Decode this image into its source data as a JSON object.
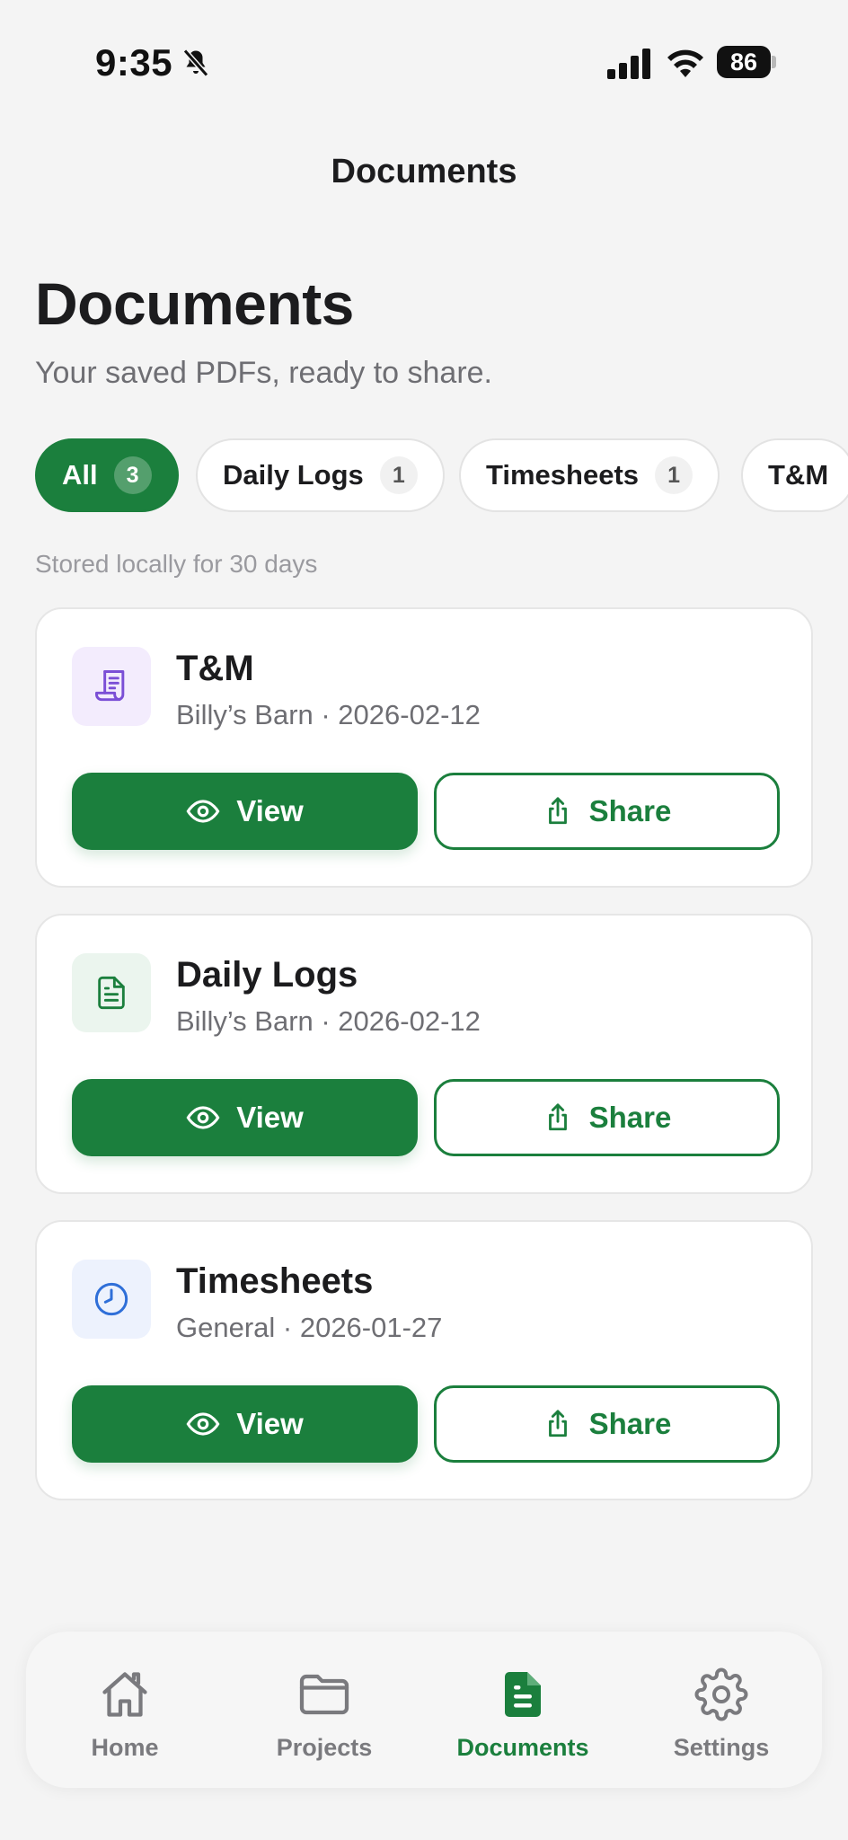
{
  "status_bar": {
    "time": "9:35",
    "battery": "86",
    "icons": [
      "bell-off-icon",
      "signal-icon",
      "wifi-icon",
      "battery-icon"
    ]
  },
  "nav": {
    "title": "Documents"
  },
  "header": {
    "title": "Documents",
    "subtitle": "Your saved PDFs, ready to share."
  },
  "filters": [
    {
      "label": "All",
      "count": "3",
      "active": true
    },
    {
      "label": "Daily Logs",
      "count": "1",
      "active": false
    },
    {
      "label": "Timesheets",
      "count": "1",
      "active": false
    },
    {
      "label": "T&M",
      "count": "",
      "active": false
    }
  ],
  "storage_note": "Stored locally for 30 days",
  "documents": [
    {
      "title": "T&M",
      "meta": "Billy’s Barn · 2026-02-12",
      "icon": "receipt-icon",
      "icon_color": "#7b4fd6",
      "icon_bg": "#f3ecfd",
      "view_label": "View",
      "share_label": "Share"
    },
    {
      "title": "Daily Logs",
      "meta": "Billy’s Barn · 2026-02-12",
      "icon": "document-icon",
      "icon_color": "#1b7f3d",
      "icon_bg": "#ebf5ee",
      "view_label": "View",
      "share_label": "Share"
    },
    {
      "title": "Timesheets",
      "meta": "General · 2026-01-27",
      "icon": "clock-icon",
      "icon_color": "#2f6fd8",
      "icon_bg": "#edf2fd",
      "view_label": "View",
      "share_label": "Share"
    }
  ],
  "tabs": [
    {
      "label": "Home",
      "icon": "home-icon",
      "active": false
    },
    {
      "label": "Projects",
      "icon": "folder-icon",
      "active": false
    },
    {
      "label": "Documents",
      "icon": "document-icon",
      "active": true
    },
    {
      "label": "Settings",
      "icon": "gear-icon",
      "active": false
    }
  ],
  "colors": {
    "accent": "#1b7f3d",
    "background": "#f4f4f4",
    "text": "#1c1c1e",
    "muted": "#6e6e73"
  }
}
